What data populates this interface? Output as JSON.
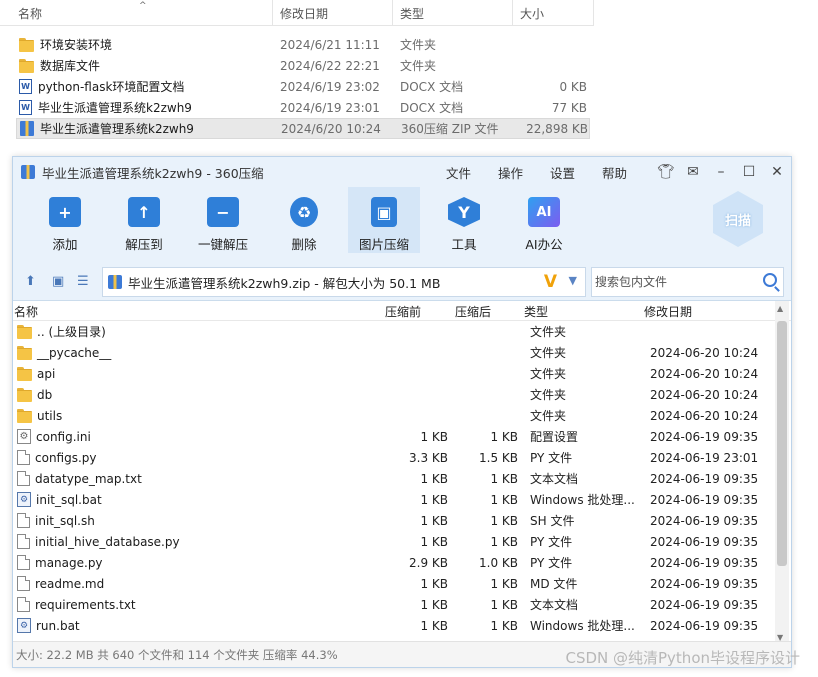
{
  "explorer": {
    "columns": [
      "名称",
      "修改日期",
      "类型",
      "大小"
    ],
    "rows": [
      {
        "name": "环境安装环境",
        "date": "2024/6/21 11:11",
        "type": "文件夹",
        "size": "",
        "icon": "folder-icon"
      },
      {
        "name": "数据库文件",
        "date": "2024/6/22 22:21",
        "type": "文件夹",
        "size": "",
        "icon": "folder-icon"
      },
      {
        "name": "python-flask环境配置文档",
        "date": "2024/6/19 23:02",
        "type": "DOCX 文档",
        "size": "0 KB",
        "icon": "word-doc-icon"
      },
      {
        "name": "毕业生派遣管理系统k2zwh9",
        "date": "2024/6/19 23:01",
        "type": "DOCX 文档",
        "size": "77 KB",
        "icon": "word-doc-icon"
      },
      {
        "name": "毕业生派遣管理系统k2zwh9",
        "date": "2024/6/20 10:24",
        "type": "360压缩 ZIP 文件",
        "size": "22,898 KB",
        "icon": "zip-archive-icon",
        "selected": true
      }
    ]
  },
  "app": {
    "title": "毕业生派遣管理系统k2zwh9 - 360压缩",
    "menus": [
      "文件",
      "操作",
      "设置",
      "帮助"
    ],
    "toolbar": [
      {
        "label": "添加",
        "icon": "add-icon",
        "color": "#2f7fd8"
      },
      {
        "label": "解压到",
        "icon": "extract-to-icon",
        "color": "#2f7fd8"
      },
      {
        "label": "一键解压",
        "icon": "one-click-extract-icon",
        "color": "#2f7fd8"
      },
      {
        "label": "删除",
        "icon": "recycle-delete-icon",
        "color": "#2f7fd8"
      },
      {
        "label": "图片压缩",
        "icon": "image-compress-icon",
        "color": "#2f7fd8"
      },
      {
        "label": "工具",
        "icon": "tools-icon",
        "color": "#2f7fd8"
      },
      {
        "label": "AI办公",
        "icon": "ai-office-icon",
        "color": "#2f7fd8"
      }
    ],
    "scan_label": "扫描",
    "address": "毕业生派遣管理系统k2zwh9.zip - 解包大小为 50.1 MB",
    "search_placeholder": "搜索包内文件",
    "list_columns": {
      "name": "名称",
      "before": "压缩前",
      "after": "压缩后",
      "type": "类型",
      "date": "修改日期"
    },
    "files": [
      {
        "name": ".. (上级目录)",
        "before": "",
        "after": "",
        "type": "文件夹",
        "date": "",
        "icon": "folder-icon"
      },
      {
        "name": "__pycache__",
        "before": "",
        "after": "",
        "type": "文件夹",
        "date": "2024-06-20 10:24",
        "icon": "folder-icon"
      },
      {
        "name": "api",
        "before": "",
        "after": "",
        "type": "文件夹",
        "date": "2024-06-20 10:24",
        "icon": "folder-icon"
      },
      {
        "name": "db",
        "before": "",
        "after": "",
        "type": "文件夹",
        "date": "2024-06-20 10:24",
        "icon": "folder-icon"
      },
      {
        "name": "utils",
        "before": "",
        "after": "",
        "type": "文件夹",
        "date": "2024-06-20 10:24",
        "icon": "folder-icon"
      },
      {
        "name": "config.ini",
        "before": "1 KB",
        "after": "1 KB",
        "type": "配置设置",
        "date": "2024-06-19 09:35",
        "icon": "config-file-icon"
      },
      {
        "name": "configs.py",
        "before": "3.3 KB",
        "after": "1.5 KB",
        "type": "PY 文件",
        "date": "2024-06-19 23:01",
        "icon": "file-icon"
      },
      {
        "name": "datatype_map.txt",
        "before": "1 KB",
        "after": "1 KB",
        "type": "文本文档",
        "date": "2024-06-19 09:35",
        "icon": "file-icon"
      },
      {
        "name": "init_sql.bat",
        "before": "1 KB",
        "after": "1 KB",
        "type": "Windows 批处理...",
        "date": "2024-06-19 09:35",
        "icon": "batch-file-icon"
      },
      {
        "name": "init_sql.sh",
        "before": "1 KB",
        "after": "1 KB",
        "type": "SH 文件",
        "date": "2024-06-19 09:35",
        "icon": "file-icon"
      },
      {
        "name": "initial_hive_database.py",
        "before": "1 KB",
        "after": "1 KB",
        "type": "PY 文件",
        "date": "2024-06-19 09:35",
        "icon": "file-icon"
      },
      {
        "name": "manage.py",
        "before": "2.9 KB",
        "after": "1.0 KB",
        "type": "PY 文件",
        "date": "2024-06-19 09:35",
        "icon": "file-icon"
      },
      {
        "name": "readme.md",
        "before": "1 KB",
        "after": "1 KB",
        "type": "MD 文件",
        "date": "2024-06-19 09:35",
        "icon": "file-icon"
      },
      {
        "name": "requirements.txt",
        "before": "1 KB",
        "after": "1 KB",
        "type": "文本文档",
        "date": "2024-06-19 09:35",
        "icon": "file-icon"
      },
      {
        "name": "run.bat",
        "before": "1 KB",
        "after": "1 KB",
        "type": "Windows 批处理...",
        "date": "2024-06-19 09:35",
        "icon": "batch-file-icon"
      }
    ],
    "status": "大小: 22.2 MB 共 640 个文件和 114 个文件夹 压缩率 44.3%"
  },
  "watermark": "CSDN @纯清Python毕设程序设计"
}
